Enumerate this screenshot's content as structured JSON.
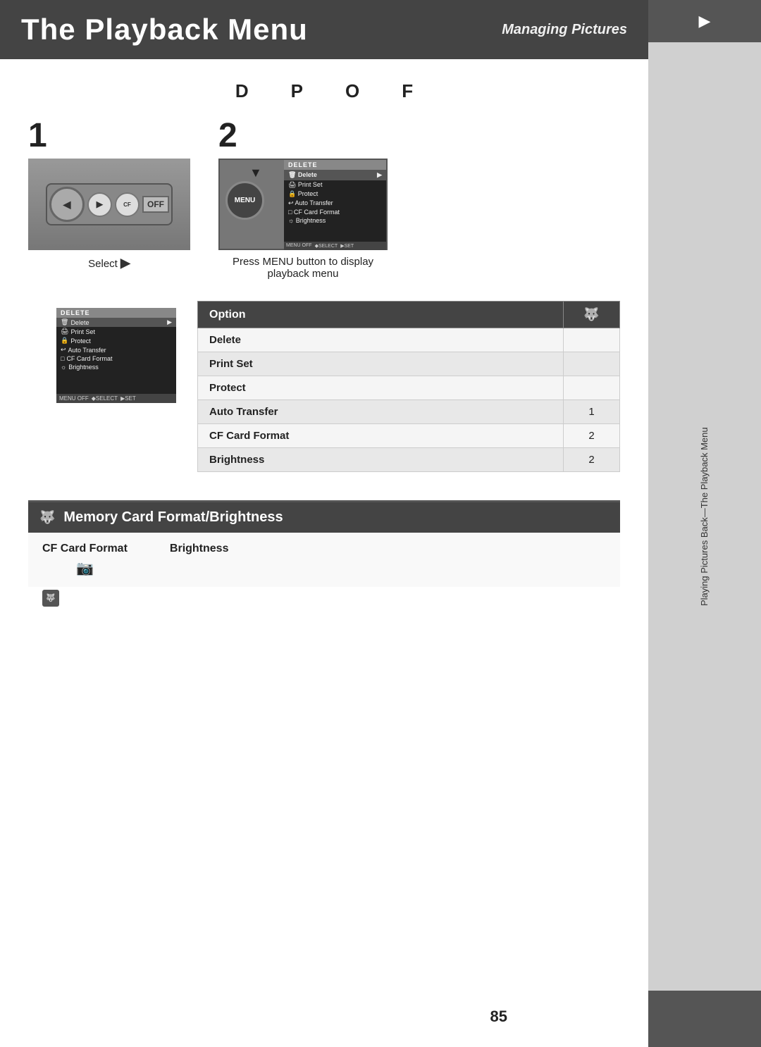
{
  "header": {
    "title": "The Playback Menu",
    "subtitle": "Managing Pictures"
  },
  "dpof": {
    "letters": [
      "D",
      "P",
      "O",
      "F"
    ]
  },
  "steps": {
    "step1": {
      "number": "1",
      "label": "Select ",
      "label_icon": "▶"
    },
    "step2": {
      "number": "2",
      "label_line1": "Press MENU button to display",
      "label_line2": "playback menu"
    }
  },
  "menu": {
    "header": "DELETE",
    "items": [
      {
        "icon": "🗑",
        "text": "Delete",
        "arrow": "▶",
        "selected": true
      },
      {
        "icon": "🖨",
        "text": "Print Set",
        "arrow": "",
        "selected": false
      },
      {
        "icon": "🔒",
        "text": "Protect",
        "arrow": "",
        "selected": false
      },
      {
        "icon": "↩",
        "text": "Auto Transfer",
        "arrow": "",
        "selected": false
      },
      {
        "icon": "□",
        "text": "CF Card Format",
        "arrow": "",
        "selected": false
      },
      {
        "icon": "☼",
        "text": "Brightness",
        "arrow": "",
        "selected": false
      }
    ],
    "footer": [
      "MENU OFF",
      "◆SELECT",
      "▶SET"
    ]
  },
  "options_table": {
    "headers": [
      "Option",
      ""
    ],
    "rows": [
      {
        "option": "Delete",
        "value": ""
      },
      {
        "option": "Print Set",
        "value": ""
      },
      {
        "option": "Protect",
        "value": ""
      },
      {
        "option": "Auto Transfer",
        "value": "1"
      },
      {
        "option": "CF Card Format",
        "value": "2"
      },
      {
        "option": "Brightness",
        "value": "2"
      }
    ]
  },
  "bottom_section": {
    "title": "Memory Card Format/Brightness",
    "col1_label": "CF Card Format",
    "col2_label": "Brightness",
    "col1_icon": "📷",
    "col2_icon": "🐺"
  },
  "sidebar": {
    "top_icon": "▶",
    "text": "Playing Pictures Back—The Playback Menu"
  },
  "page_number": "85"
}
